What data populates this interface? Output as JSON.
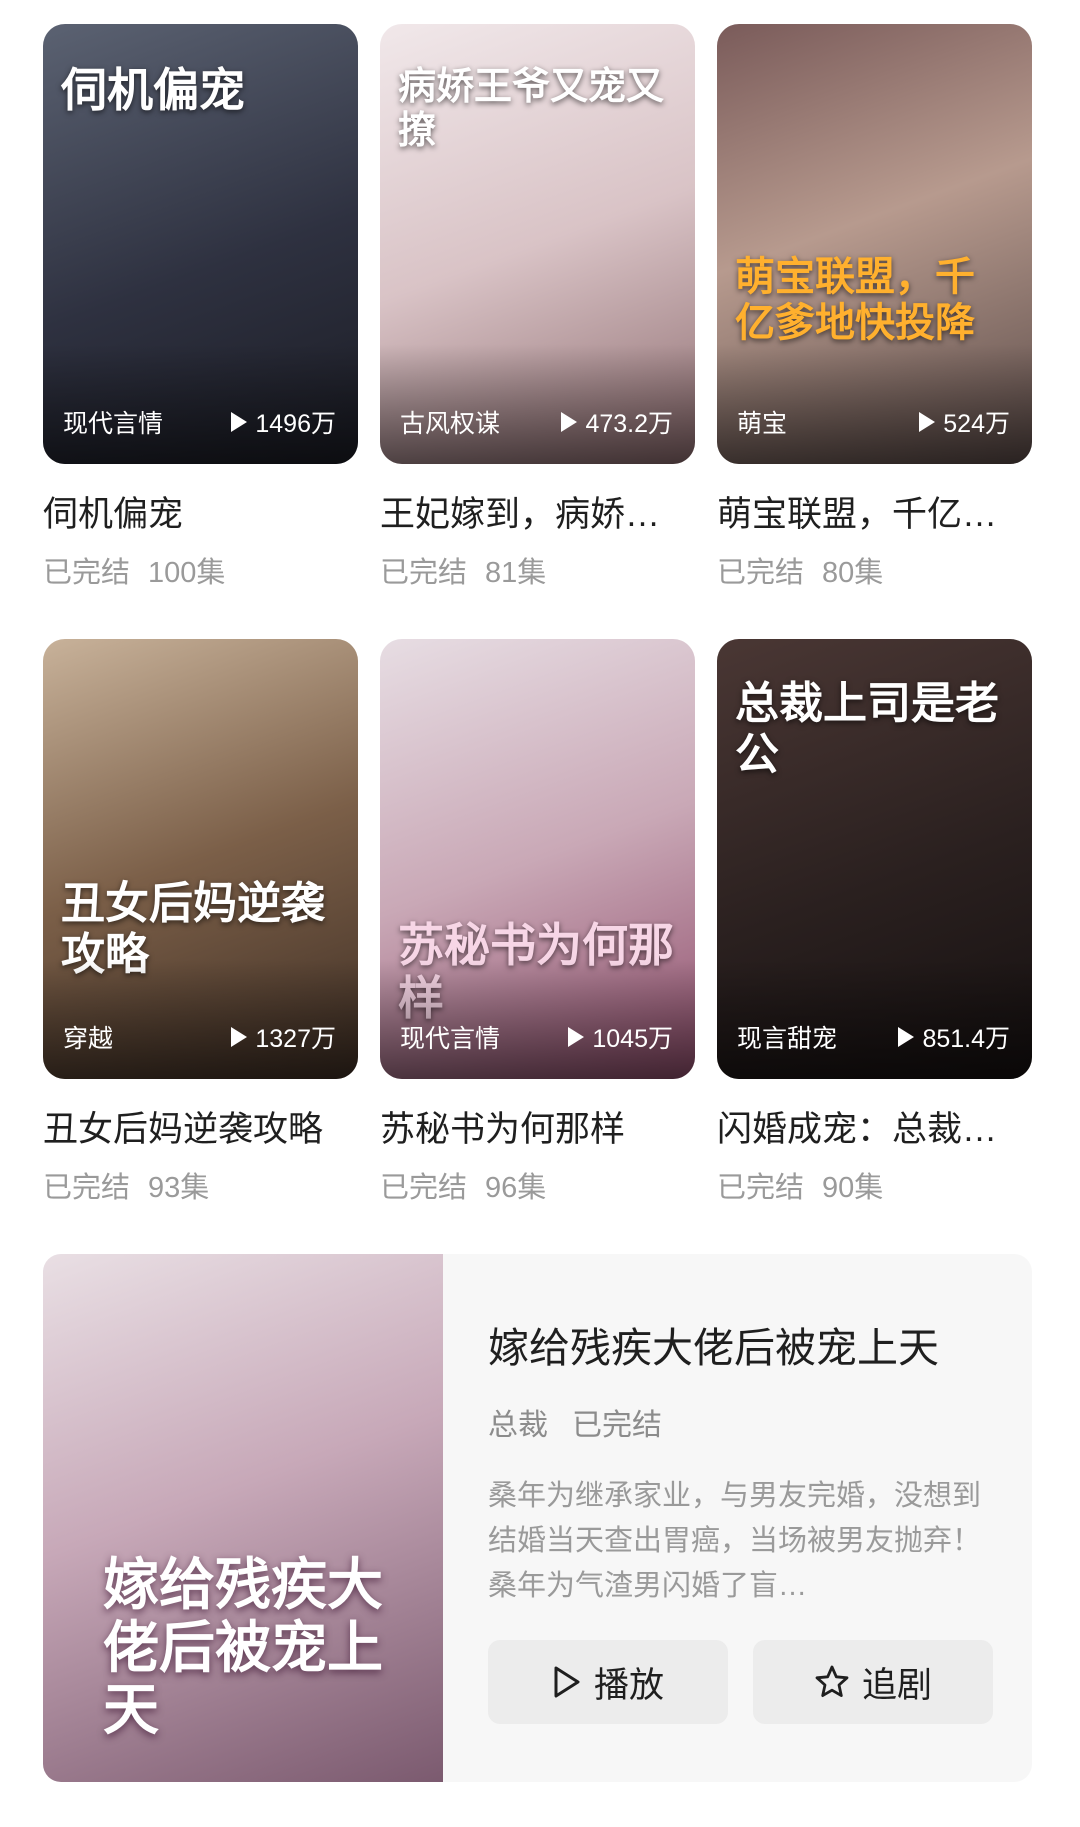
{
  "dramas": [
    {
      "cover_title": "伺机偏宠",
      "genre": "现代言情",
      "views": "1496万",
      "title": "伺机偏宠",
      "status": "已完结",
      "episodes": "100集",
      "bg": "linear-gradient(160deg,#5b6272 0%,#2e3140 55%,#1b1c24 100%)"
    },
    {
      "cover_title": "病娇王爷又宠又撩",
      "genre": "古风权谋",
      "views": "473.2万",
      "title": "王妃嫁到，病娇王爷又宠又撩",
      "status": "已完结",
      "episodes": "81集",
      "bg": "linear-gradient(160deg,#f1e8ea 0%,#d9c3c6 50%,#8e6d70 100%)"
    },
    {
      "cover_title": "萌宝联盟，千亿爹地快投降",
      "genre": "萌宝",
      "views": "524万",
      "title": "萌宝联盟，千亿爹地快投降",
      "status": "已完结",
      "episodes": "80集",
      "bg": "linear-gradient(160deg,#7a5b5a 0%,#b79a8e 45%,#5b4b48 100%)"
    },
    {
      "cover_title": "丑女后妈逆袭攻略",
      "genre": "穿越",
      "views": "1327万",
      "title": "丑女后妈逆袭攻略",
      "status": "已完结",
      "episodes": "93集",
      "bg": "linear-gradient(160deg,#c8b29a 0%,#7b5f48 50%,#3e2e24 100%)"
    },
    {
      "cover_title": "苏秘书为何那样",
      "genre": "现代言情",
      "views": "1045万",
      "title": "苏秘书为何那样",
      "status": "已完结",
      "episodes": "96集",
      "bg": "linear-gradient(160deg,#e7dde3 0%,#c9a8b6 50%,#8f4d6b 100%)"
    },
    {
      "cover_title": "总裁上司是老公",
      "genre": "现言甜宠",
      "views": "851.4万",
      "title": "闪婚成宠：总裁上司是老公",
      "status": "已完结",
      "episodes": "90集",
      "bg": "linear-gradient(160deg,#4a3734 0%,#2a201f 55%,#151010 100%)"
    }
  ],
  "featured": {
    "cover_title": "嫁给残疾大佬后被宠上天",
    "title": "嫁给残疾大佬后被宠上天",
    "tag": "总裁",
    "status": "已完结",
    "description": "桑年为继承家业，与男友完婚，没想到结婚当天查出胃癌，当场被男友抛弃！桑年为气渣男闪婚了盲…",
    "play_label": "播放",
    "follow_label": "追剧"
  }
}
